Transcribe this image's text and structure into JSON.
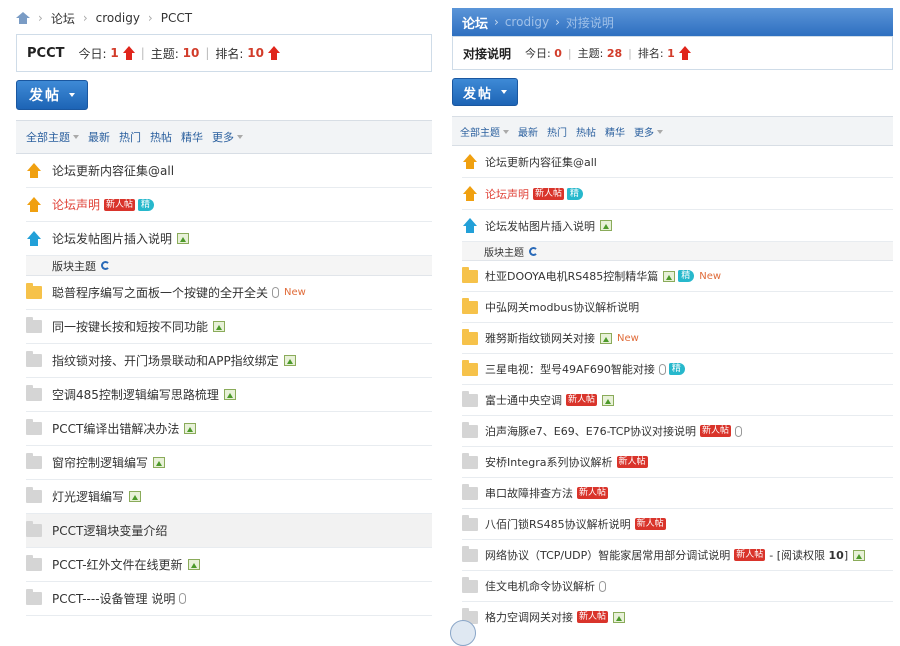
{
  "left": {
    "breadcrumb": {
      "root": "论坛",
      "user": "crodigy",
      "current": "PCCT"
    },
    "header": {
      "forum_name": "PCCT",
      "today_label": "今日:",
      "today": "1",
      "topics_label": "主题:",
      "topics": "10",
      "rank_label": "排名:",
      "rank": "10"
    },
    "post_button": "发帖",
    "filters": [
      "全部主题",
      "最新",
      "热门",
      "热帖",
      "精华",
      "更多"
    ],
    "pinned": [
      {
        "title": "论坛更新内容征集@all",
        "icon": "pin-orange"
      },
      {
        "title": "论坛声明",
        "icon": "pin-orange",
        "badge_new": "新人帖",
        "badge_jing": "精"
      },
      {
        "title": "论坛发帖图片插入说明",
        "icon": "pin-blue"
      }
    ],
    "section_label": "版块主题",
    "threads": [
      {
        "title": "聪普程序编写之面板一个按键的全开全关",
        "new": "New"
      },
      {
        "title": "同一按键长按和短按不同功能"
      },
      {
        "title": "指纹锁对接、开门场景联动和APP指纹绑定"
      },
      {
        "title": "空调485控制逻辑编写思路梳理"
      },
      {
        "title": "PCCT编译出错解决办法"
      },
      {
        "title": "窗帘控制逻辑编写"
      },
      {
        "title": "灯光逻辑编写"
      },
      {
        "title": "PCCT逻辑块变量介绍"
      },
      {
        "title": "PCCT-红外文件在线更新"
      },
      {
        "title": "PCCT----设备管理 说明"
      }
    ]
  },
  "right": {
    "topbar": {
      "forum": "论坛",
      "user": "crodigy",
      "current": "对接说明"
    },
    "header": {
      "forum_name": "对接说明",
      "today_label": "今日:",
      "today": "0",
      "topics_label": "主题:",
      "topics": "28",
      "rank_label": "排名:",
      "rank": "1"
    },
    "post_button": "发帖",
    "filters": [
      "全部主题",
      "最新",
      "热门",
      "热帖",
      "精华",
      "更多"
    ],
    "pinned": [
      {
        "title": "论坛更新内容征集@all"
      },
      {
        "title": "论坛声明",
        "badge_new": "新人帖",
        "badge_jing": "精"
      },
      {
        "title": "论坛发帖图片插入说明"
      }
    ],
    "section_label": "版块主题",
    "threads": [
      {
        "title": "杜亚DOOYA电机RS485控制精华篇",
        "badge_jing": "精",
        "new": "New"
      },
      {
        "title": "中弘网关modbus协议解析说明"
      },
      {
        "title": "雅努斯指纹锁网关对接",
        "new": "New"
      },
      {
        "title": "三星电视：型号49AF690智能对接",
        "badge_jing": "精"
      },
      {
        "title": "富士通中央空调",
        "badge_new": "新人帖"
      },
      {
        "title": "泊声海豚e7、E69、E76-TCP协议对接说明",
        "badge_new": "新人帖"
      },
      {
        "title": "安桥Integra系列协议解析",
        "badge_new": "新人帖"
      },
      {
        "title": "串口故障排查方法",
        "badge_new": "新人帖"
      },
      {
        "title": "八佰门锁RS485协议解析说明",
        "badge_new": "新人帖"
      },
      {
        "title": "网络协议（TCP/UDP）智能家居常用部分调试说明",
        "badge_new": "新人帖",
        "read_perm": "- [阅读权限 ",
        "read_perm_num": "10",
        "read_perm_end": "]"
      },
      {
        "title": "佳文电机命令协议解析"
      },
      {
        "title": "格力空调网关对接",
        "badge_new": "新人帖"
      }
    ]
  }
}
